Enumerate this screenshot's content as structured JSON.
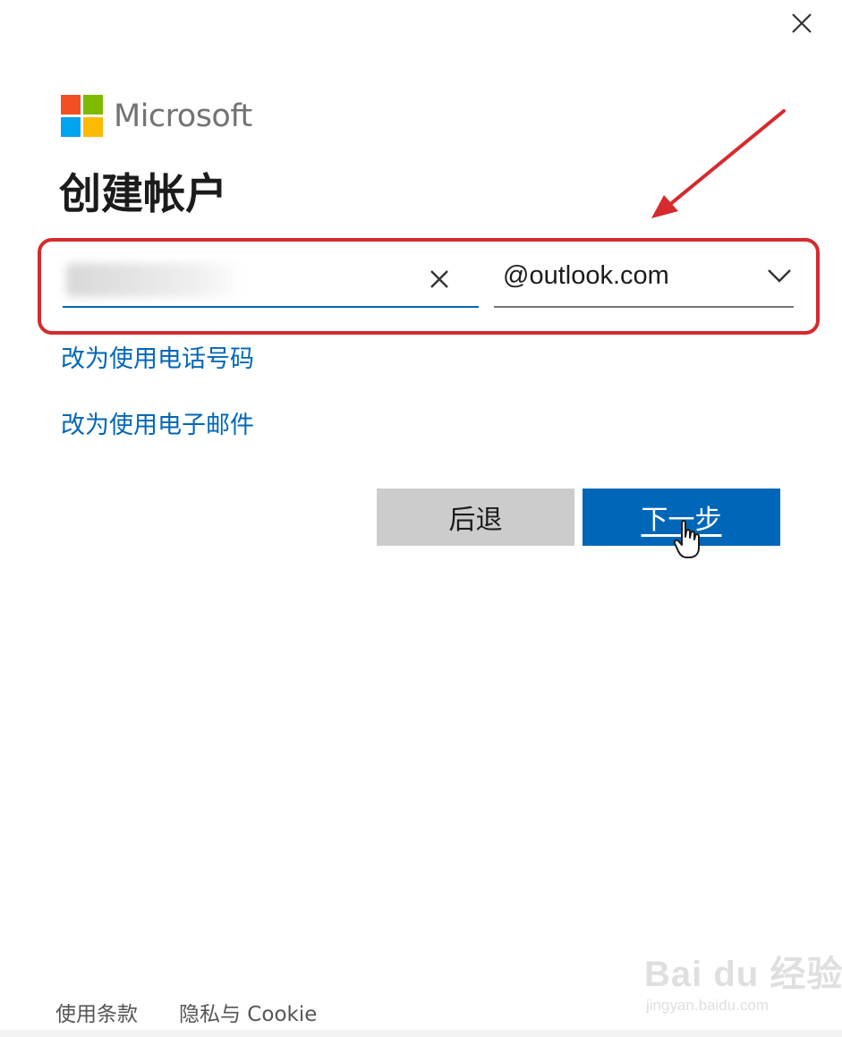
{
  "window": {
    "close_icon": "close-icon"
  },
  "logo": {
    "wordmark": "Microsoft",
    "colors": [
      "#f25022",
      "#7fba00",
      "#00a4ef",
      "#ffb900"
    ]
  },
  "title": "创建帐户",
  "email_field": {
    "value": "",
    "placeholder": "",
    "clear_icon": "clear-x-icon"
  },
  "domain_select": {
    "selected": "@outlook.com",
    "icon": "chevron-down-icon"
  },
  "links": {
    "use_phone": "改为使用电话号码",
    "use_email": "改为使用电子邮件"
  },
  "buttons": {
    "back": "后退",
    "next": "下一步"
  },
  "footer": {
    "terms": "使用条款",
    "privacy": "隐私与 Cookie"
  },
  "watermark": {
    "main": "Bai du 经验",
    "sub": "jingyan.baidu.com"
  },
  "colors": {
    "accent": "#0067b8",
    "annotation": "#d62a2e",
    "back_button": "#cccccc"
  }
}
